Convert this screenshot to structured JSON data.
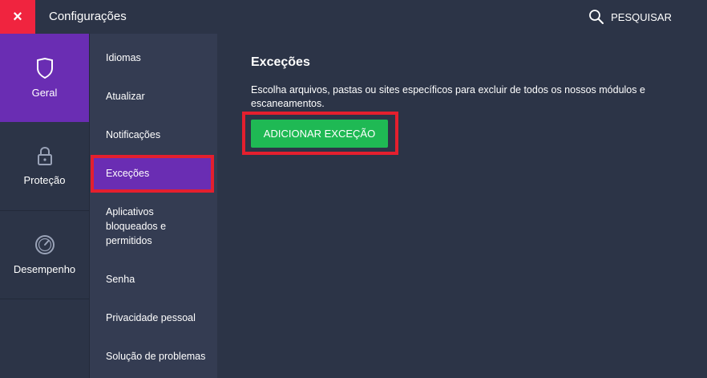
{
  "window": {
    "title": "Configurações",
    "close_symbol": "×"
  },
  "search": {
    "label": "PESQUISAR",
    "icon": "search-icon"
  },
  "categories": [
    {
      "label": "Geral",
      "icon": "shield-icon",
      "active": true
    },
    {
      "label": "Proteção",
      "icon": "lock-icon",
      "active": false
    },
    {
      "label": "Desempenho",
      "icon": "gauge-icon",
      "active": false
    }
  ],
  "submenu": [
    {
      "label": "Idiomas"
    },
    {
      "label": "Atualizar"
    },
    {
      "label": "Notificações"
    },
    {
      "label": "Exceções",
      "active": true
    },
    {
      "label": "Aplicativos bloqueados e permitidos"
    },
    {
      "label": "Senha"
    },
    {
      "label": "Privacidade pessoal"
    },
    {
      "label": "Solução de problemas"
    }
  ],
  "main": {
    "heading": "Exceções",
    "description": "Escolha arquivos, pastas ou sites específicos para excluir de todos os nossos módulos e escaneamentos.",
    "add_button": "ADICIONAR EXCEÇÃO"
  },
  "colors": {
    "background": "#2c3447",
    "submenu_bg": "#343c52",
    "accent_purple": "#6a2db3",
    "close_red": "#f0243f",
    "highlight_red": "#e41f2e",
    "button_green": "#1fb954"
  }
}
